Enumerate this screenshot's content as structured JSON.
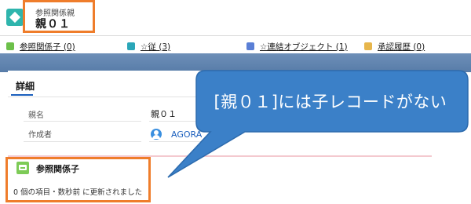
{
  "header": {
    "record_type": "参照関係親",
    "record_name": "親０１"
  },
  "related_links": [
    {
      "label": "参照関係子 (0)",
      "color": "#6cc04a"
    },
    {
      "label": "☆従 (3)",
      "color": "#2aa6b8"
    },
    {
      "label": "☆連結オブジェクト (1)",
      "color": "#5a7fd6"
    },
    {
      "label": "承認履歴 (0)",
      "color": "#e7b64c"
    }
  ],
  "detail": {
    "tab_label": "詳細",
    "fields": [
      {
        "label": "親名",
        "value": "親０１"
      },
      {
        "label": "作成者",
        "value": "AGORA"
      }
    ]
  },
  "related_list": {
    "title": "参照関係子",
    "status": "0 個の項目・数秒前 に更新されました"
  },
  "callout": {
    "text": "[親０１]には子レコードがない",
    "color": "#3b80c8"
  },
  "highlight_color": "#ef7d2b"
}
